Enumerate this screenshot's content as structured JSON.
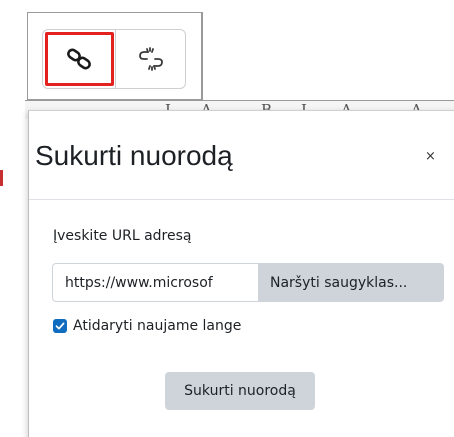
{
  "toolbar": {
    "buttons": [
      {
        "icon": "link-icon",
        "selected": true
      },
      {
        "icon": "unlink-icon",
        "selected": false
      }
    ],
    "highlight_color": "#e3211f",
    "strip_glyphs": [
      "I",
      "A",
      "B",
      "I",
      "A",
      "A"
    ]
  },
  "dialog": {
    "title": "Sukurti nuorodą",
    "close_label": "×",
    "url_label": "Įveskite URL adresą",
    "url_value": "https://www.microsof",
    "browse_label": "Naršyti saugyklas...",
    "new_window_checked": true,
    "new_window_label": "Atidaryti naujame lange",
    "submit_label": "Sukurti nuorodą",
    "accent_color": "#0f6cbf"
  }
}
